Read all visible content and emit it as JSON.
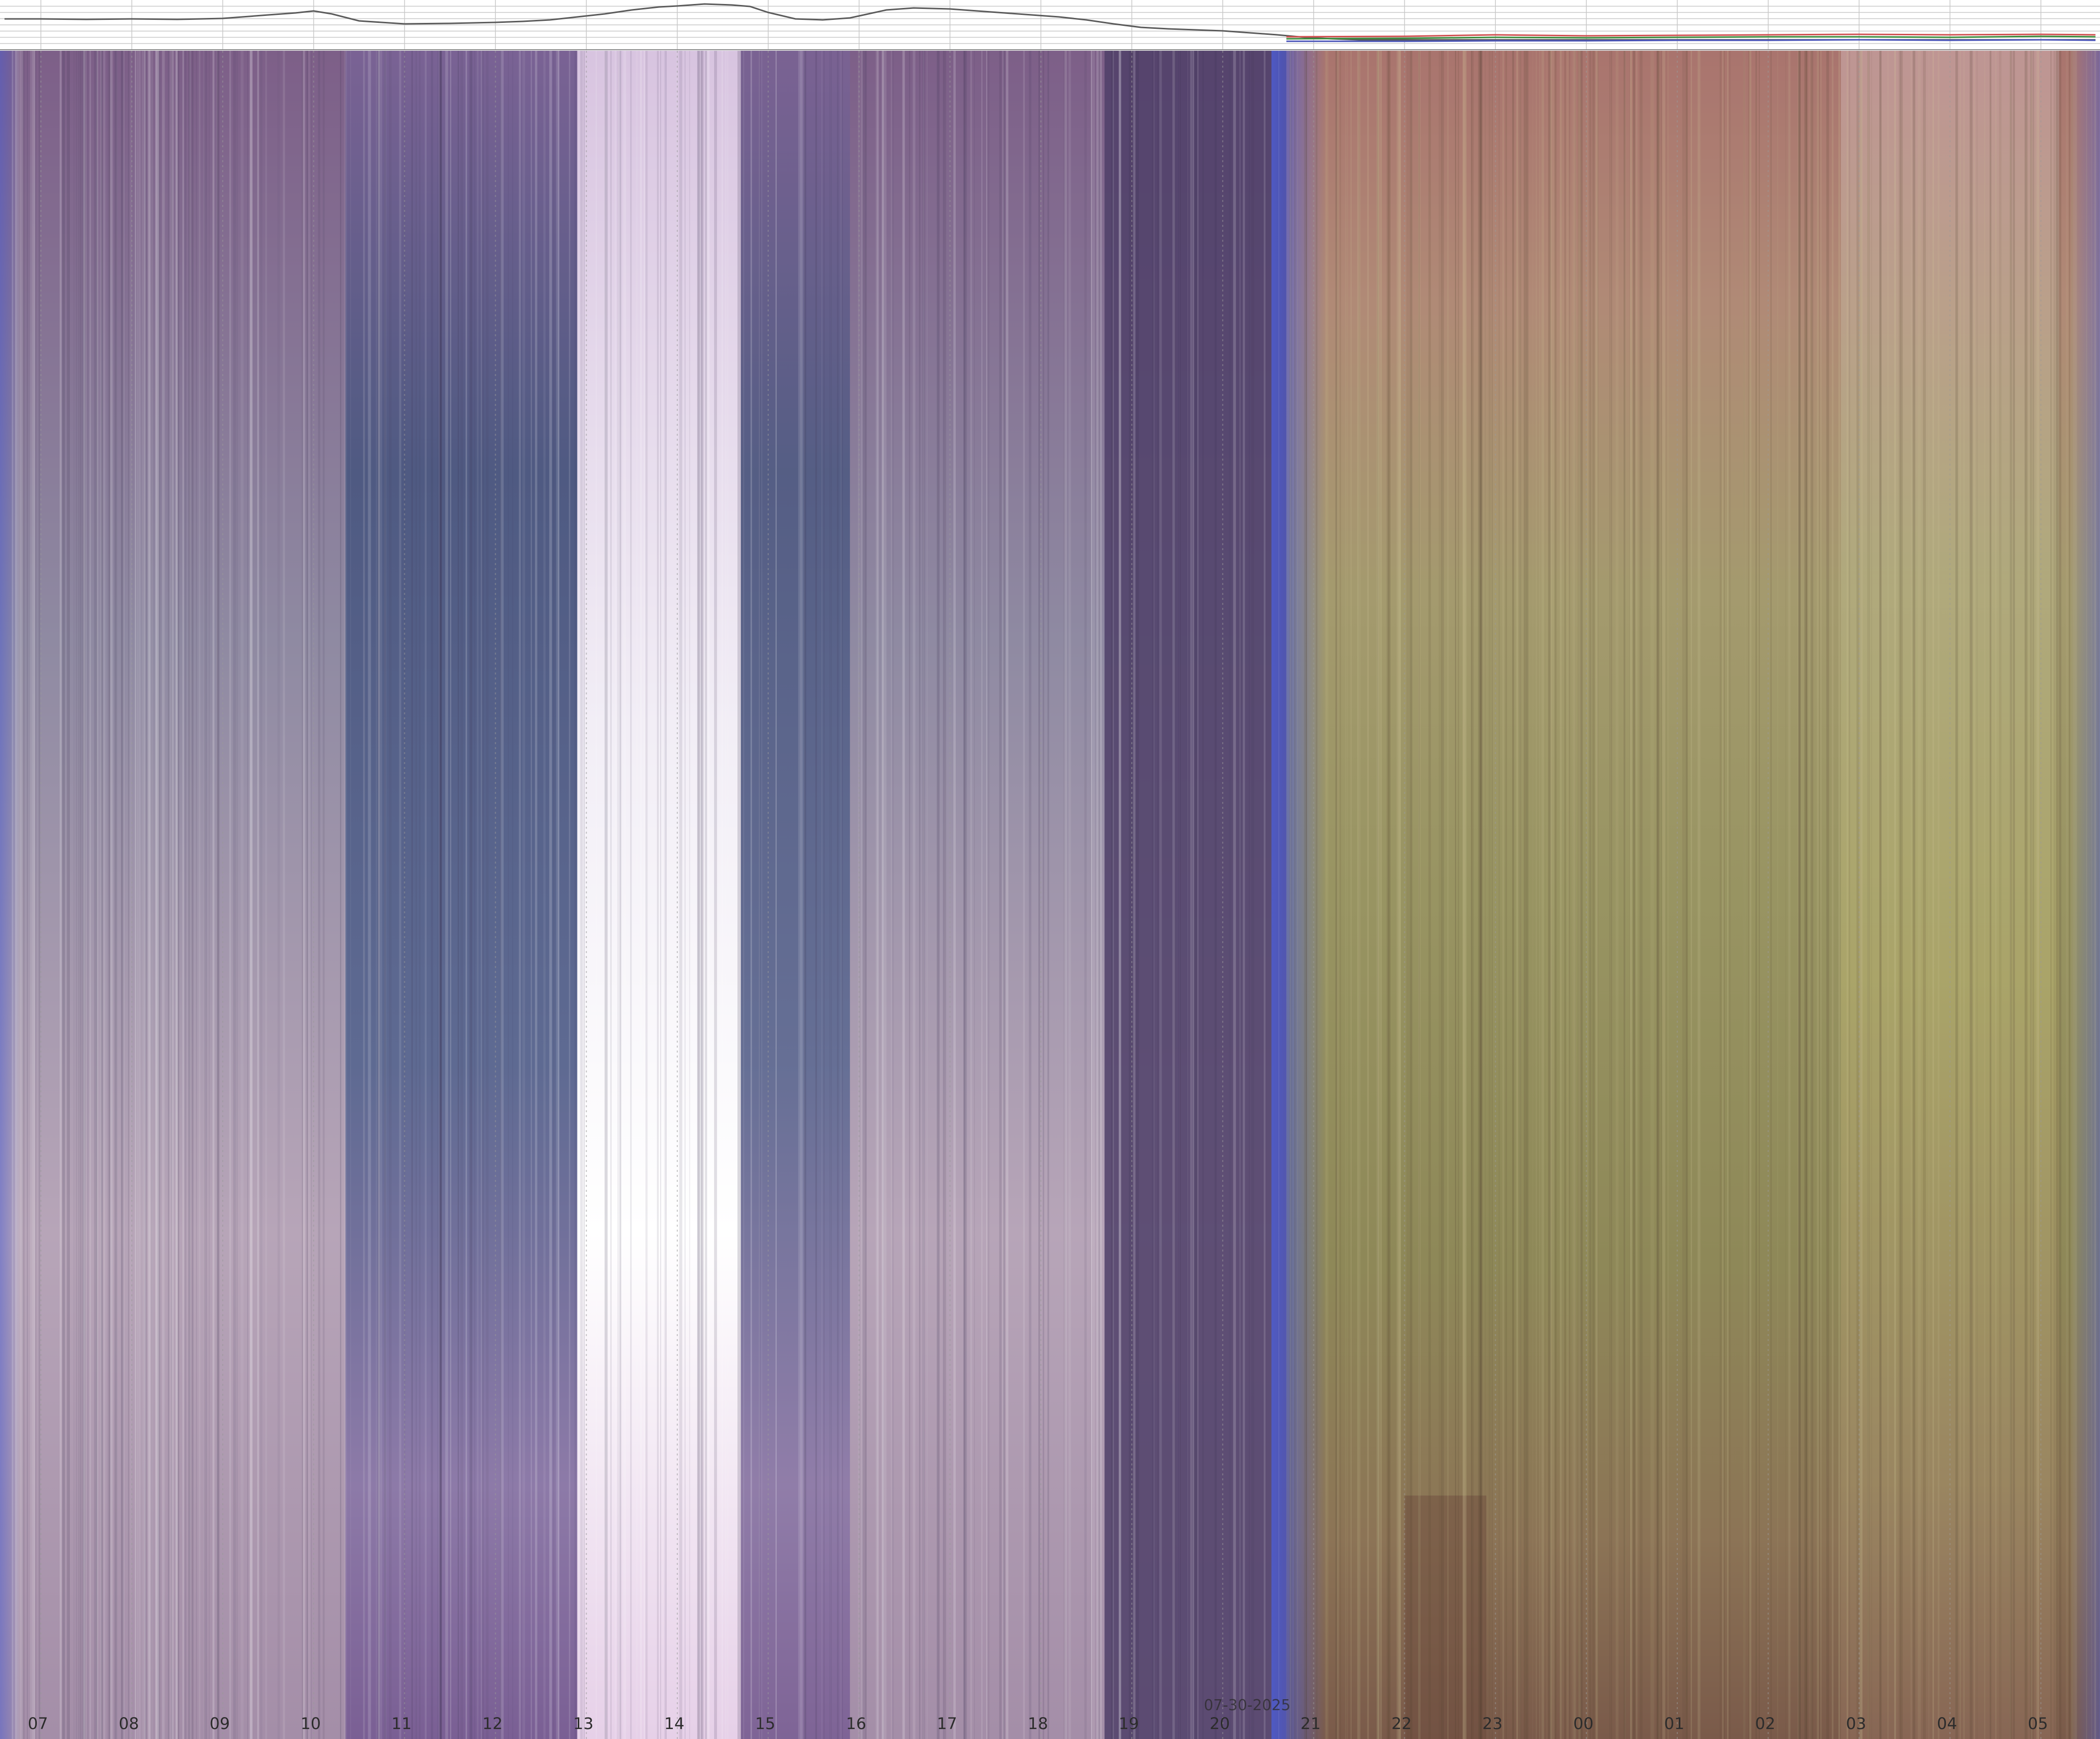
{
  "chart_data": {
    "type": "keogram",
    "date_label": "07-30-2025",
    "hour_labels": [
      "07",
      "08",
      "09",
      "10",
      "11",
      "12",
      "13",
      "14",
      "15",
      "16",
      "17",
      "18",
      "19",
      "20",
      "21",
      "22",
      "23",
      "00",
      "01",
      "02",
      "03",
      "04",
      "05"
    ],
    "hour_ticks": [
      7,
      8,
      9,
      10,
      11,
      12,
      13,
      14,
      15,
      16,
      17,
      18,
      19,
      20,
      21,
      22,
      23,
      24,
      25,
      26,
      27,
      28,
      29
    ],
    "time_range": [
      6.55,
      29.65
    ],
    "sky_phases": [
      {
        "name": "day",
        "start": 6.55,
        "end": 20.7
      },
      {
        "name": "night",
        "start": 20.7,
        "end": 29.65
      }
    ],
    "brightness_series": {
      "x": [
        6.6,
        7.0,
        7.5,
        8.0,
        8.5,
        9.0,
        9.5,
        9.8,
        10.0,
        10.2,
        10.5,
        11.0,
        11.5,
        12.0,
        12.3,
        12.6,
        12.9,
        13.2,
        13.5,
        13.8,
        14.0,
        14.3,
        14.6,
        14.8,
        15.0,
        15.3,
        15.6,
        15.9,
        16.1,
        16.3,
        16.6,
        17.0,
        17.3,
        17.6,
        17.9,
        18.2,
        18.5,
        18.8,
        19.1,
        19.4,
        19.7,
        20.0,
        20.3,
        20.6,
        20.9,
        21.2,
        21.5,
        22.0,
        23.0,
        24.0,
        25.0,
        26.0,
        27.0,
        28.0,
        29.0,
        29.6
      ],
      "y": [
        0.62,
        0.62,
        0.61,
        0.62,
        0.61,
        0.63,
        0.7,
        0.74,
        0.78,
        0.72,
        0.58,
        0.52,
        0.53,
        0.55,
        0.57,
        0.6,
        0.66,
        0.72,
        0.8,
        0.86,
        0.88,
        0.92,
        0.9,
        0.87,
        0.75,
        0.62,
        0.6,
        0.64,
        0.72,
        0.8,
        0.84,
        0.82,
        0.78,
        0.74,
        0.7,
        0.66,
        0.6,
        0.52,
        0.45,
        0.42,
        0.4,
        0.38,
        0.34,
        0.3,
        0.25,
        0.22,
        0.2,
        0.2,
        0.2,
        0.2,
        0.2,
        0.2,
        0.2,
        0.2,
        0.2,
        0.2
      ],
      "y_range": [
        0,
        1
      ]
    },
    "channel_series": [
      {
        "color": "#d05050",
        "x": [
          20.7,
          22,
          23,
          24,
          25,
          26,
          27,
          28,
          29,
          29.6
        ],
        "y": [
          0.26,
          0.27,
          0.3,
          0.28,
          0.29,
          0.3,
          0.31,
          0.3,
          0.31,
          0.3
        ]
      },
      {
        "color": "#3c8c3c",
        "x": [
          20.7,
          22,
          23,
          24,
          25,
          26,
          27,
          28,
          29,
          29.6
        ],
        "y": [
          0.22,
          0.23,
          0.25,
          0.24,
          0.25,
          0.26,
          0.26,
          0.25,
          0.27,
          0.26
        ]
      },
      {
        "color": "#4a55b8",
        "x": [
          20.7,
          22,
          23,
          24,
          25,
          26,
          27,
          28,
          29,
          29.6
        ],
        "y": [
          0.17,
          0.17,
          0.18,
          0.18,
          0.19,
          0.19,
          0.2,
          0.19,
          0.2,
          0.19
        ]
      }
    ],
    "gridlines": true,
    "colors": {
      "axis_text": "#2c2c2c",
      "grid": "#9a9a9a",
      "day_sky": "#6a5b8c",
      "night_sky": "#9e9868",
      "horizon_band": "#5c6dcc"
    }
  }
}
